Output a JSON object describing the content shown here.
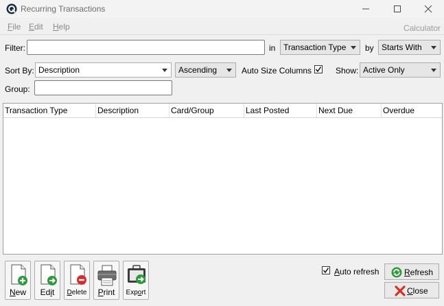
{
  "window": {
    "title": "Recurring Transactions",
    "calculator": "Calculator"
  },
  "menu": {
    "file": {
      "key": "F",
      "rest": "ile"
    },
    "edit": {
      "key": "E",
      "rest": "dit"
    },
    "help": {
      "key": "H",
      "rest": "elp"
    }
  },
  "filter": {
    "label": "Filter:",
    "value": "",
    "in_label": "in",
    "field": "Transaction Type",
    "by_label": "by",
    "mode": "Starts With"
  },
  "sort": {
    "label": "Sort By:",
    "field": "Description",
    "order": "Ascending",
    "auto_size_label": "Auto Size Columns",
    "auto_size_checked": true,
    "show_label": "Show:",
    "show_value": "Active Only"
  },
  "group": {
    "label": "Group:",
    "value": ""
  },
  "table": {
    "columns": [
      "Transaction Type",
      "Description",
      "Card/Group",
      "Last Posted",
      "Next Due",
      "Overdue"
    ],
    "rows": []
  },
  "toolbar": {
    "new": {
      "key": "N",
      "rest": "ew"
    },
    "edit": {
      "pre": "Ed",
      "key": "i",
      "rest": "t"
    },
    "delete": {
      "key": "D",
      "rest": "elete"
    },
    "print": {
      "key": "P",
      "rest": "rint"
    },
    "export": {
      "pre": "Exp",
      "key": "o",
      "rest": "rt"
    }
  },
  "auto_refresh": {
    "pre": "",
    "key": "A",
    "rest": "uto refresh",
    "checked": true
  },
  "buttons": {
    "refresh": {
      "key": "R",
      "rest": "efresh"
    },
    "close": {
      "key": "C",
      "rest": "lose"
    }
  },
  "colors": {
    "accent_green": "#2e9b3a",
    "delete_red": "#d92b2b",
    "close_red": "#d93025"
  }
}
